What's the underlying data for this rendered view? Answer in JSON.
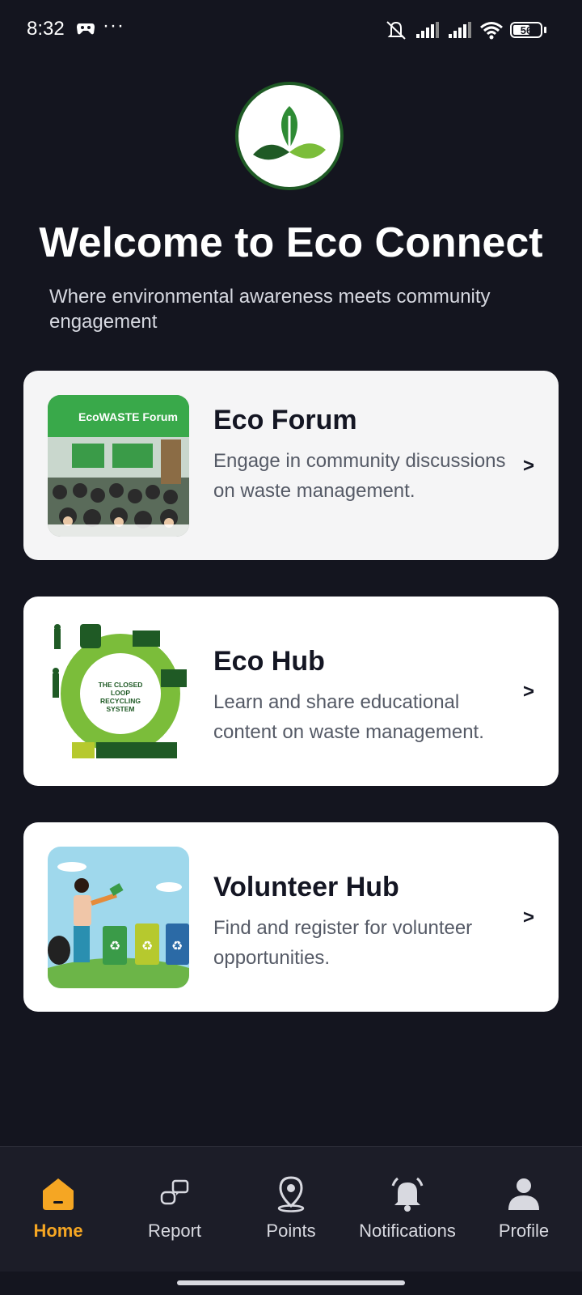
{
  "status_bar": {
    "time": "8:32",
    "dots": "···",
    "battery": "56"
  },
  "header": {
    "title": "Welcome to Eco Connect",
    "subtitle": "Where environmental awareness meets community engagement",
    "logo_icon": "leaf-logo-icon"
  },
  "cards": [
    {
      "title": "Eco Forum",
      "description": "Engage in community discussions on waste management.",
      "chevron": ">",
      "image_text": "EcoWASTE Forum"
    },
    {
      "title": "Eco Hub",
      "description": "Learn and share educational content on waste management.",
      "chevron": ">",
      "image_text": "THE CLOSED LOOP RECYCLING SYSTEM"
    },
    {
      "title": "Volunteer Hub",
      "description": "Find and register for volunteer opportunities.",
      "chevron": ">"
    }
  ],
  "nav": {
    "items": [
      {
        "label": "Home",
        "icon": "home-icon",
        "active": true
      },
      {
        "label": "Report",
        "icon": "chat-report-icon",
        "active": false
      },
      {
        "label": "Points",
        "icon": "location-pin-icon",
        "active": false
      },
      {
        "label": "Notifications",
        "icon": "bell-icon",
        "active": false
      },
      {
        "label": "Profile",
        "icon": "person-icon",
        "active": false
      }
    ]
  },
  "colors": {
    "background": "#14151f",
    "accent": "#f5a623",
    "brand_green": "#1f5a25"
  }
}
